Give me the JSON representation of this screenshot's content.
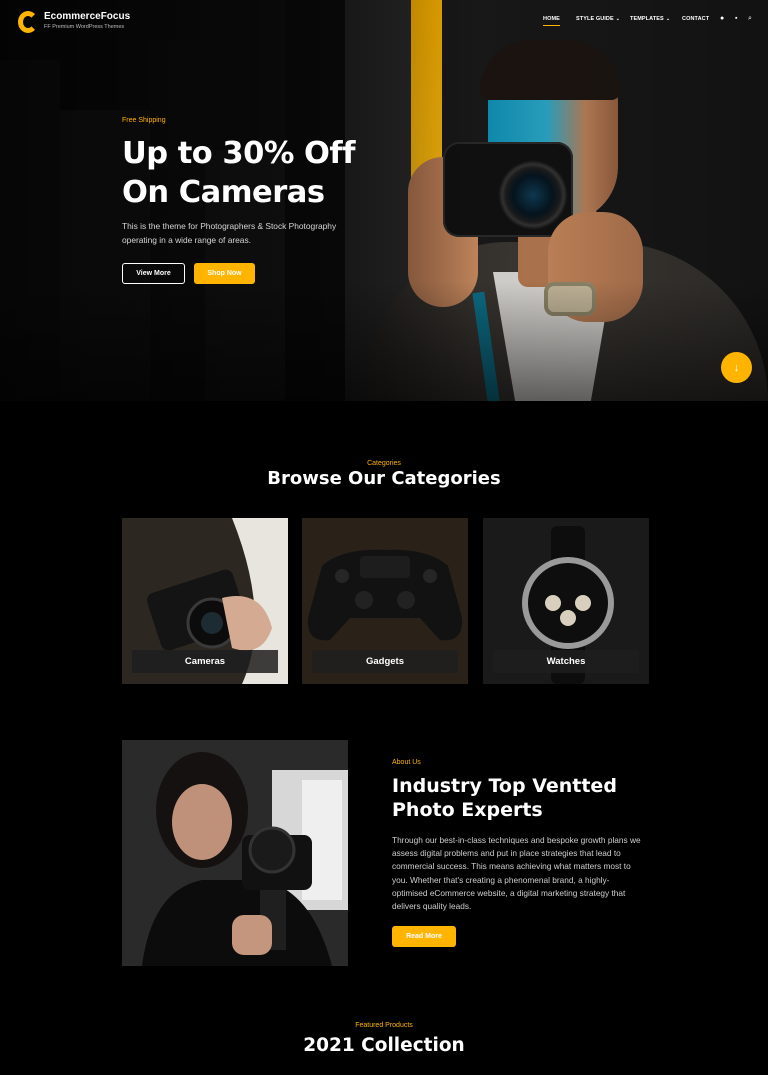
{
  "brand": {
    "name": "EcommerceFocus",
    "tagline": "FF Premium WordPress Themes"
  },
  "nav": {
    "items": [
      {
        "label": "HOME",
        "active": true
      },
      {
        "label": "STYLE GUIDE",
        "dropdown": true
      },
      {
        "label": "TEMPLATES",
        "dropdown": true
      },
      {
        "label": "CONTACT"
      }
    ],
    "icons": [
      "user-icon",
      "cart-icon",
      "search-icon"
    ]
  },
  "hero": {
    "eyebrow": "Free Shipping",
    "title_line1": "Up to 30% Off",
    "title_line2": "On Cameras",
    "description": "This is the theme for Photographers & Stock Photography operating in a wide range of areas.",
    "primary_button": "View More",
    "secondary_button": "Shop Now",
    "scroll_icon": "arrow-down-icon"
  },
  "categories": {
    "eyebrow": "Categories",
    "title": "Browse Our Categories",
    "items": [
      {
        "label": "Cameras"
      },
      {
        "label": "Gadgets"
      },
      {
        "label": "Watches"
      }
    ]
  },
  "about": {
    "eyebrow": "About Us",
    "title_line1": "Industry Top Ventted",
    "title_line2": "Photo Experts",
    "description": "Through our best-in-class techniques and bespoke growth plans we assess digital problems and put in place strategies that lead to commercial success. This means achieving what matters most to you. Whether that's creating a phenomenal brand, a highly-optimised eCommerce website, a digital marketing strategy that delivers quality leads.",
    "button": "Read More"
  },
  "featured": {
    "eyebrow": "Featured Products",
    "title": "2021 Collection"
  },
  "colors": {
    "accent": "#ffb400",
    "background": "#000000",
    "text": "#ffffff"
  }
}
